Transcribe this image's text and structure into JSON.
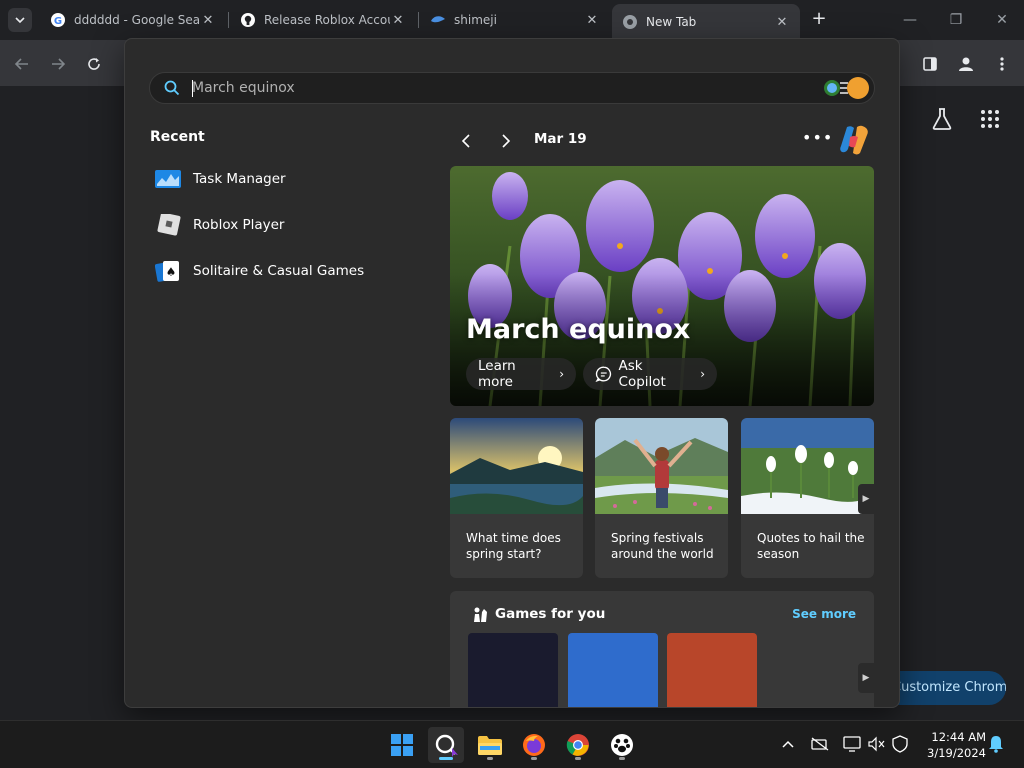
{
  "browser": {
    "tabs": [
      {
        "title": "dddddd - Google Search",
        "icon": "google-icon"
      },
      {
        "title": "Release Roblox Account",
        "icon": "github-icon"
      },
      {
        "title": "shimeji",
        "icon": "shimeji-icon"
      },
      {
        "title": "New Tab",
        "icon": "chrome-icon",
        "active": true
      }
    ],
    "new_tab_label": "+",
    "close_glyph": "✕",
    "customize_label": "Customize Chrome"
  },
  "flyout": {
    "search": {
      "value": "",
      "placeholder": "March equinox"
    },
    "recent": {
      "heading": "Recent",
      "items": [
        {
          "label": "Task Manager",
          "icon": "task-manager-icon"
        },
        {
          "label": "Roblox Player",
          "icon": "roblox-icon"
        },
        {
          "label": "Solitaire & Casual Games",
          "icon": "solitaire-icon"
        }
      ]
    },
    "highlights": {
      "date": "Mar 19",
      "hero": {
        "title": "March equinox",
        "learn_more": "Learn more",
        "ask_copilot": "Ask Copilot"
      },
      "cards": [
        {
          "text": "What time does spring start?"
        },
        {
          "text": "Spring festivals around the world"
        },
        {
          "text": "Quotes to hail the season"
        }
      ],
      "games": {
        "title": "Games for you",
        "see_more": "See more",
        "tile_colors": [
          "#1a1b2e",
          "#2f6ccc",
          "#b8462a"
        ]
      }
    }
  },
  "taskbar": {
    "apps": [
      {
        "name": "start",
        "icon": "windows-start-icon"
      },
      {
        "name": "search",
        "icon": "search-icon",
        "active": true
      },
      {
        "name": "file-explorer",
        "icon": "folder-icon"
      },
      {
        "name": "firefox",
        "icon": "firefox-icon"
      },
      {
        "name": "chrome",
        "icon": "chrome-icon"
      },
      {
        "name": "app",
        "icon": "paw-icon"
      }
    ],
    "clock": {
      "time": "12:44 AM",
      "date": "3/19/2024"
    }
  },
  "colors": {
    "accent": "#60cdff",
    "flyout_bg": "#2b2b2b",
    "card_bg": "#383838",
    "taskbar_bg": "#1c1c1c"
  }
}
